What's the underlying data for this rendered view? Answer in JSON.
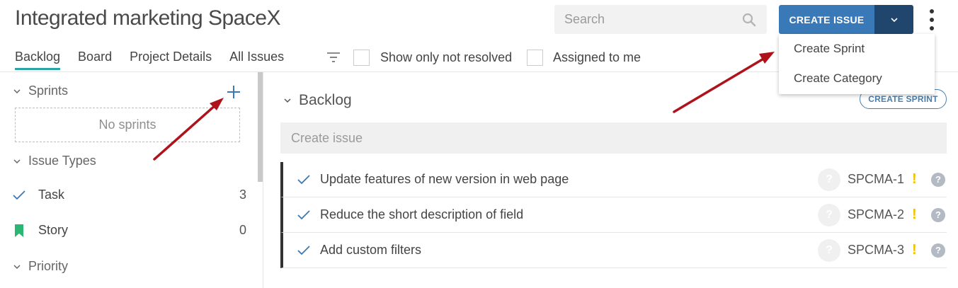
{
  "header": {
    "title": "Integrated marketing SpaceX",
    "search_placeholder": "Search",
    "create_issue_label": "CREATE ISSUE"
  },
  "tabs": [
    {
      "label": "Backlog",
      "active": true
    },
    {
      "label": "Board"
    },
    {
      "label": "Project Details"
    },
    {
      "label": "All Issues"
    }
  ],
  "filters": {
    "show_not_resolved": "Show only not resolved",
    "assigned_to_me": "Assigned to me"
  },
  "sidebar": {
    "sprints_label": "Sprints",
    "no_sprints": "No sprints",
    "issue_types_label": "Issue Types",
    "types": [
      {
        "name": "Task",
        "count": "3",
        "icon": "check-icon"
      },
      {
        "name": "Story",
        "count": "0",
        "icon": "bookmark-icon"
      }
    ],
    "priority_label": "Priority"
  },
  "backlog": {
    "title": "Backlog",
    "create_sprint_label": "CREATE SPRINT",
    "create_issue_placeholder": "Create issue",
    "issues": [
      {
        "summary": "Update features of new version in web page",
        "key": "SPCMA-1",
        "priority": "!",
        "status": "?"
      },
      {
        "summary": "Reduce the short description of field",
        "key": "SPCMA-2",
        "priority": "!",
        "status": "?"
      },
      {
        "summary": "Add custom filters",
        "key": "SPCMA-3",
        "priority": "!",
        "status": "?"
      }
    ]
  },
  "dropdown": {
    "items": [
      "Create Sprint",
      "Create Category"
    ]
  },
  "colors": {
    "primary": "#3a79b8",
    "primary_dark": "#21466d",
    "tab_underline": "#2aa6a6",
    "story_green": "#2bb673",
    "priority_yellow": "#f4c200",
    "annotation_red": "#b0121b"
  }
}
